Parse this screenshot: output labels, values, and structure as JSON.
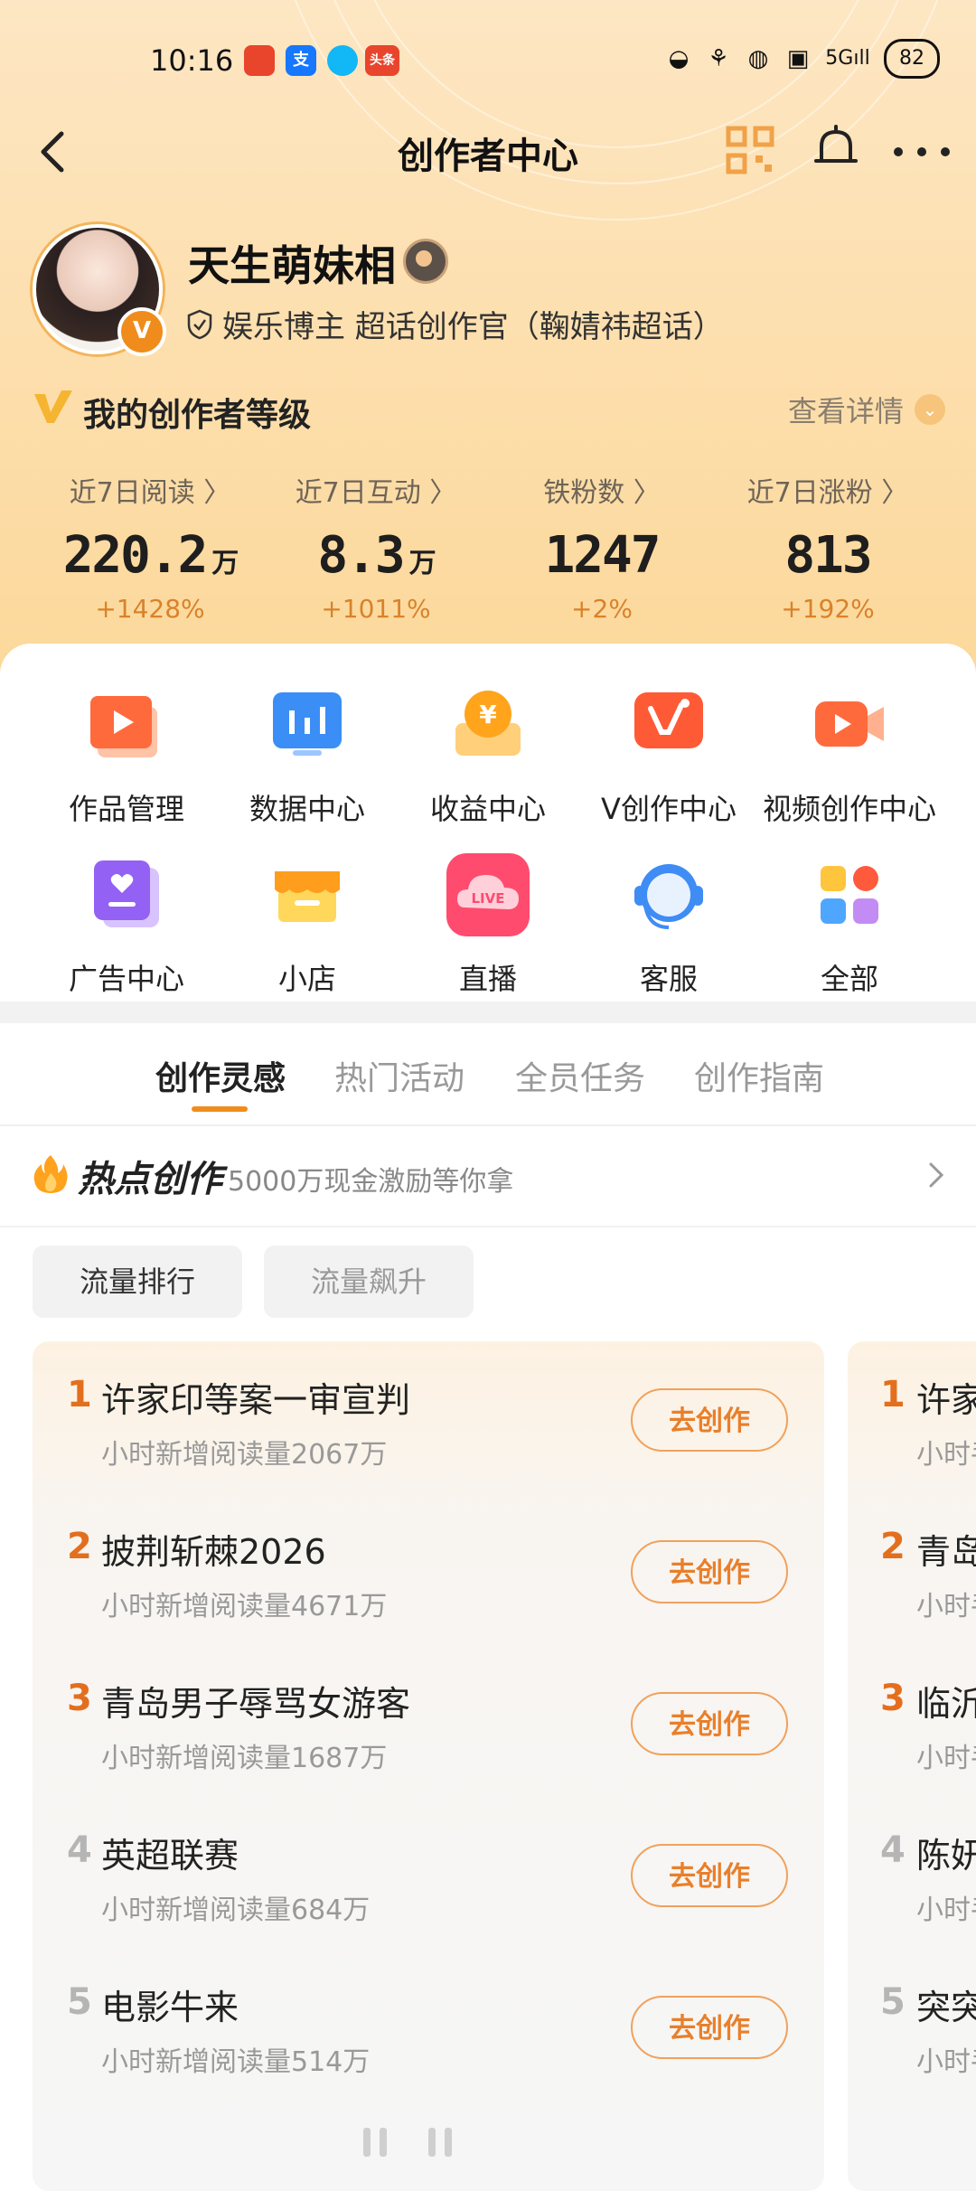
{
  "status_bar": {
    "time": "10:16",
    "notifications": [
      {
        "icon": "app-icon-red",
        "color": "#e8452c",
        "label": "🔴"
      },
      {
        "icon": "alipay-icon",
        "color": "#1677ff",
        "label": "支"
      },
      {
        "icon": "qq-icon",
        "color": "#12b7f5",
        "label": ""
      },
      {
        "icon": "toutiao-icon",
        "color": "#e8452c",
        "label": "头条"
      }
    ],
    "battery": "82"
  },
  "nav": {
    "title": "创作者中心"
  },
  "profile": {
    "name": "天生萌妹相",
    "subtitle": "娱乐博主 超话创作官（鞠婧祎超话）",
    "verified_badge": "V"
  },
  "level": {
    "title": "我的创作者等级",
    "detail_link": "查看详情"
  },
  "stats": [
    {
      "label": "近7日阅读 〉",
      "value": "220.2",
      "unit": "万",
      "change": "+1428%"
    },
    {
      "label": "近7日互动 〉",
      "value": "8.3",
      "unit": "万",
      "change": "+1011%"
    },
    {
      "label": "铁粉数 〉",
      "value": "1247",
      "unit": "",
      "change": "+2%"
    },
    {
      "label": "近7日涨粉 〉",
      "value": "813",
      "unit": "",
      "change": "+192%"
    }
  ],
  "tools": [
    {
      "label": "作品管理",
      "icon": "works-management-icon"
    },
    {
      "label": "数据中心",
      "icon": "data-center-icon"
    },
    {
      "label": "收益中心",
      "icon": "revenue-center-icon"
    },
    {
      "label": "V创作中心",
      "icon": "v-creation-center-icon"
    },
    {
      "label": "视频创作中心",
      "icon": "video-creation-center-icon"
    },
    {
      "label": "广告中心",
      "icon": "ad-center-icon"
    },
    {
      "label": "小店",
      "icon": "shop-icon"
    },
    {
      "label": "直播",
      "icon": "live-icon",
      "badge": "LIVE"
    },
    {
      "label": "客服",
      "icon": "customer-service-icon"
    },
    {
      "label": "全部",
      "icon": "all-apps-icon"
    }
  ],
  "tabs": [
    {
      "label": "创作灵感",
      "active": true
    },
    {
      "label": "热门活动",
      "active": false
    },
    {
      "label": "全员任务",
      "active": false
    },
    {
      "label": "创作指南",
      "active": false
    }
  ],
  "hot": {
    "title": "热点创作",
    "subtitle": "5000万现金激励等你拿"
  },
  "filters": [
    {
      "label": "流量排行",
      "active": true
    },
    {
      "label": "流量飙升",
      "active": false
    }
  ],
  "colors": {
    "accent": "#f08c1c",
    "rank_top": "#e36f1e",
    "rank_other": "#b5b5b5"
  },
  "list": [
    {
      "rank": "1",
      "title": "许家印等案一审宣判",
      "sub": "小时新增阅读量2067万",
      "action": "去创作"
    },
    {
      "rank": "2",
      "title": "披荆斩棘2026",
      "sub": "小时新增阅读量4671万",
      "action": "去创作"
    },
    {
      "rank": "3",
      "title": "青岛男子辱骂女游客",
      "sub": "小时新增阅读量1687万",
      "action": "去创作"
    },
    {
      "rank": "4",
      "title": "英超联赛",
      "sub": "小时新增阅读量684万",
      "action": "去创作"
    },
    {
      "rank": "5",
      "title": "电影牛来",
      "sub": "小时新增阅读量514万",
      "action": "去创作"
    }
  ],
  "list2": [
    {
      "rank": "1",
      "title": "许家",
      "sub": "小时手"
    },
    {
      "rank": "2",
      "title": "青岛",
      "sub": "小时手"
    },
    {
      "rank": "3",
      "title": "临沂",
      "sub": "小时手"
    },
    {
      "rank": "4",
      "title": "陈妍",
      "sub": "小时手"
    },
    {
      "rank": "5",
      "title": "突突",
      "sub": "小时手"
    }
  ]
}
